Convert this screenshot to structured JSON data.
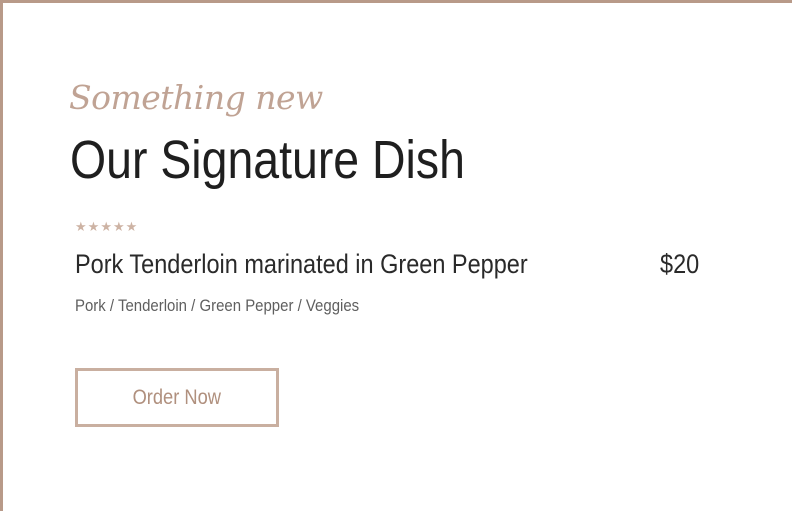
{
  "section": {
    "eyebrow": "Something new",
    "title": "Our Signature Dish"
  },
  "dish": {
    "rating": 5,
    "rating_max": 5,
    "stars": [
      "★",
      "★",
      "★",
      "★",
      "★"
    ],
    "name": "Pork Tenderloin marinated in Green Pepper",
    "price": "$20",
    "ingredients": "Pork / Tenderloin / Green Pepper / Veggies"
  },
  "cta": {
    "order_label": "Order Now"
  },
  "colors": {
    "accent": "#b89a89",
    "star": "#cdb3a4",
    "button_border": "#c9afa0",
    "button_text": "#b0907e",
    "title_text": "#1f1f1f"
  },
  "icons": {
    "rating_star": "star-icon"
  }
}
